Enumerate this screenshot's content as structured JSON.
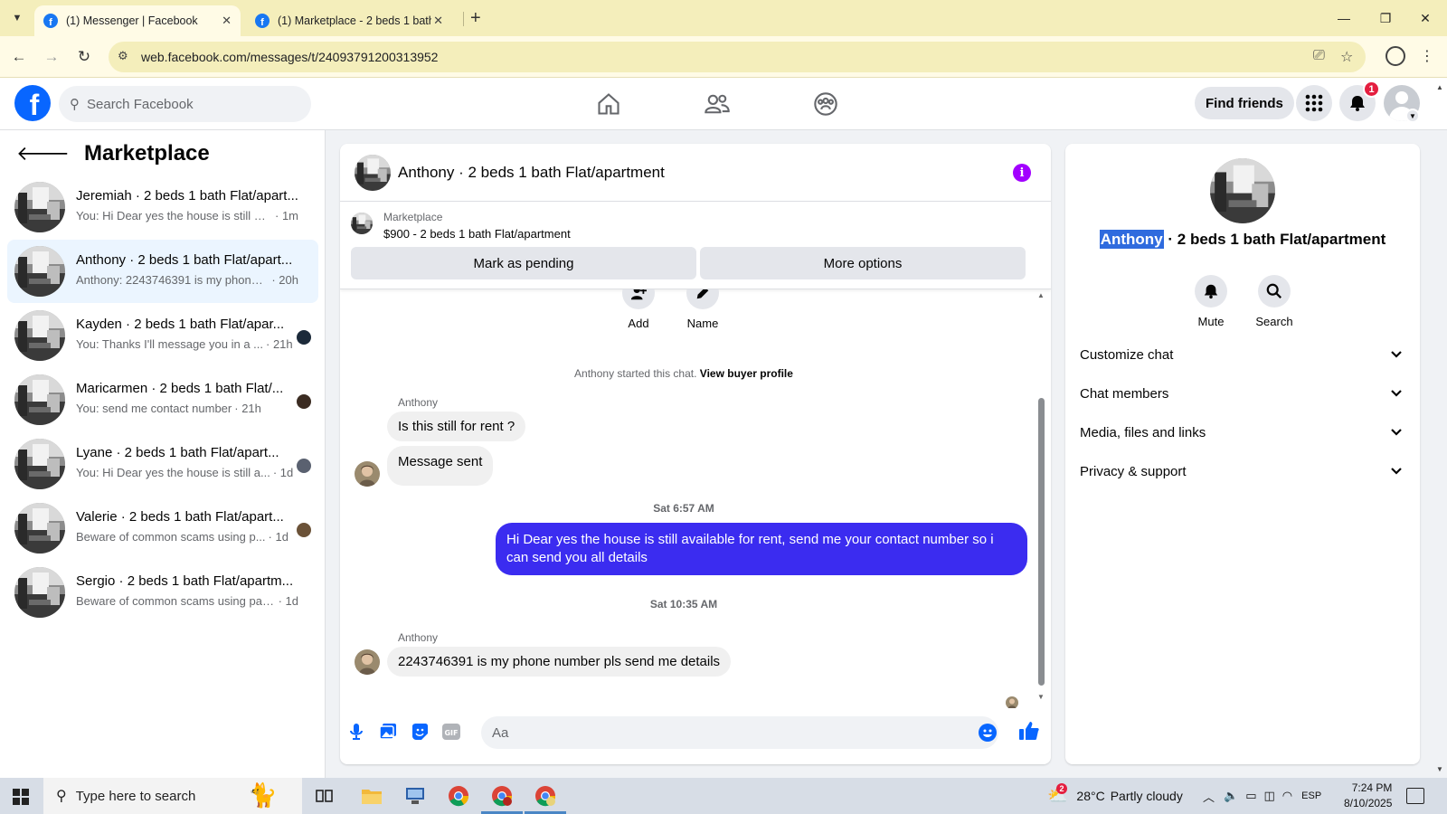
{
  "browser": {
    "tabs": [
      {
        "title": "(1) Messenger | Facebook",
        "active": true
      },
      {
        "title": "(1) Marketplace - 2 beds 1 bath",
        "active": false
      }
    ],
    "url": "web.facebook.com/messages/t/24093791200313952"
  },
  "header": {
    "search_placeholder": "Search Facebook",
    "find_friends": "Find friends",
    "notification_count": "1",
    "colors": {
      "brand": "#0866ff",
      "badge": "#e41e3f"
    }
  },
  "sidebar": {
    "title": "Marketplace",
    "conversations": [
      {
        "title": "Jeremiah · 2 beds 1 bath Flat/apart...",
        "snippet": "You: Hi Dear yes the house is still avai...",
        "time": "· 1m",
        "selected": false
      },
      {
        "title": "Anthony · 2 beds 1 bath Flat/apart...",
        "snippet": "Anthony: 2243746391 is my phone n...",
        "time": "· 20h",
        "selected": true
      },
      {
        "title": "Kayden · 2 beds 1 bath Flat/apar...",
        "snippet": "You: Thanks I'll message you in a ...",
        "time": "· 21h",
        "selected": false
      },
      {
        "title": "Maricarmen · 2 beds 1 bath Flat/...",
        "snippet": "You: send me contact number",
        "time": "· 21h",
        "selected": false
      },
      {
        "title": "Lyane · 2 beds 1 bath Flat/apart...",
        "snippet": "You: Hi Dear yes the house is still a...",
        "time": "· 1d",
        "selected": false
      },
      {
        "title": "Valerie · 2 beds 1 bath Flat/apart...",
        "snippet": "Beware of common scams using p...",
        "time": "· 1d",
        "selected": false
      },
      {
        "title": "Sergio · 2 beds 1 bath Flat/apartm...",
        "snippet": "Beware of common scams using pay...",
        "time": "· 1d",
        "selected": false
      }
    ]
  },
  "chat": {
    "title": "Anthony · 2 beds 1 bath Flat/apartment",
    "marketplace_label": "Marketplace",
    "listing": "$900 - 2 beds 1 bath Flat/apartment",
    "mark_pending": "Mark as pending",
    "more_options": "More options",
    "quick_add": "Add",
    "quick_name": "Name",
    "started_text": "Anthony started this chat.",
    "view_profile": "View buyer profile",
    "sender_name": "Anthony",
    "messages": {
      "in1": "Is this still for rent ?",
      "in2": "Message sent",
      "ts1": "Sat 6:57 AM",
      "out1": "Hi Dear yes the house is still available for rent, send me your contact number so i can send you all details",
      "ts2": "Sat 10:35 AM",
      "in3": "2243746391 is my phone number pls send me details"
    },
    "composer_placeholder": "Aa",
    "colors": {
      "outgoing": "#3b2cf0",
      "info": "#a200ff"
    }
  },
  "details": {
    "name_first": "Anthony",
    "name_rest": " · 2 beds 1 bath Flat/apartment",
    "mute": "Mute",
    "search": "Search",
    "sections": [
      "Customize chat",
      "Chat members",
      "Media, files and links",
      "Privacy & support"
    ]
  },
  "taskbar": {
    "search_placeholder": "Type here to search",
    "weather_badge": "2",
    "temperature": "28°C",
    "weather": "Partly cloudy",
    "lang": "ESP",
    "time": "7:24 PM",
    "date": "8/10/2025"
  }
}
